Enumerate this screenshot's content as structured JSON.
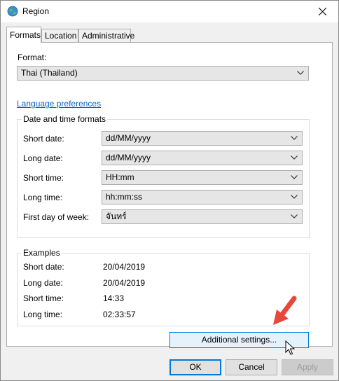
{
  "window": {
    "title": "Region",
    "app_icon": "globe-icon",
    "close_icon": "close-icon"
  },
  "tabs": [
    {
      "label": "Formats",
      "active": true
    },
    {
      "label": "Location",
      "active": false
    },
    {
      "label": "Administrative",
      "active": false
    }
  ],
  "format": {
    "label": "Format:",
    "value": "Thai (Thailand)"
  },
  "language_link": "Language preferences",
  "datetime": {
    "title": "Date and time formats",
    "rows": [
      {
        "label": "Short date:",
        "value": "dd/MM/yyyy"
      },
      {
        "label": "Long date:",
        "value": "dd/MM/yyyy"
      },
      {
        "label": "Short time:",
        "value": "HH:mm"
      },
      {
        "label": "Long time:",
        "value": "hh:mm:ss"
      },
      {
        "label": "First day of week:",
        "value": "จันทร์"
      }
    ]
  },
  "examples": {
    "title": "Examples",
    "rows": [
      {
        "label": "Short date:",
        "value": "20/04/2019"
      },
      {
        "label": "Long date:",
        "value": "20/04/2019"
      },
      {
        "label": "Short time:",
        "value": "14:33"
      },
      {
        "label": "Long time:",
        "value": "02:33:57"
      }
    ]
  },
  "buttons": {
    "additional": "Additional settings...",
    "ok": "OK",
    "cancel": "Cancel",
    "apply": "Apply"
  },
  "colors": {
    "accent": "#0078d7",
    "link": "#0066cc",
    "arrow": "#e8473a"
  }
}
